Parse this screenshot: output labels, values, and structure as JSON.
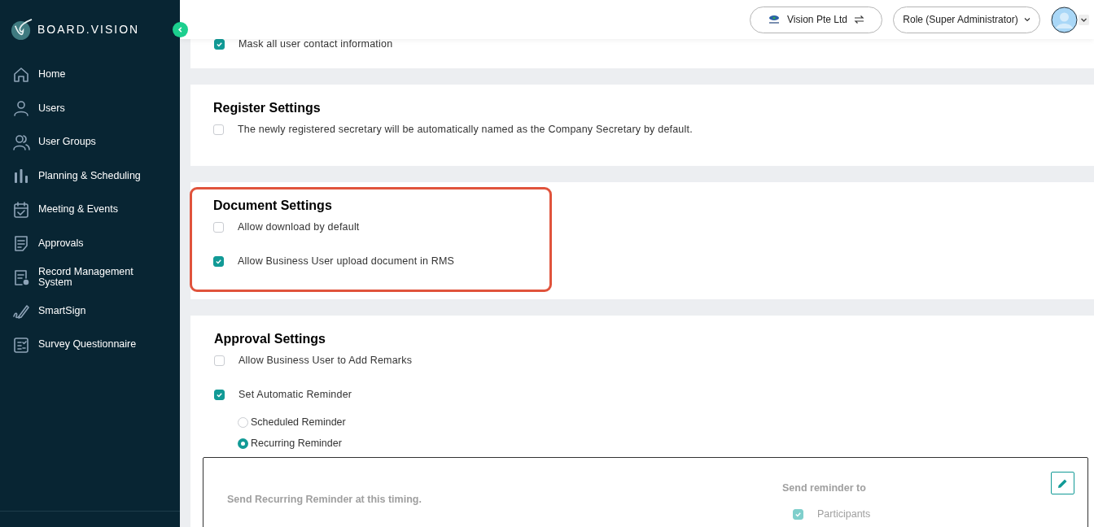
{
  "sidebar": {
    "logo_text": "BOARD.VISION",
    "items": [
      {
        "label": "Home"
      },
      {
        "label": "Users"
      },
      {
        "label": "User Groups"
      },
      {
        "label": "Planning & Scheduling"
      },
      {
        "label": "Meeting & Events"
      },
      {
        "label": "Approvals"
      },
      {
        "label": "Record Management System"
      },
      {
        "label": "SmartSign"
      },
      {
        "label": "Survey Questionnaire"
      }
    ]
  },
  "header": {
    "company": "Vision Pte Ltd",
    "role": "Role (Super Administrator)"
  },
  "sections": [
    {
      "highlighted": false,
      "options": [
        {
          "label": "Mask all user contact information",
          "checked": true
        }
      ]
    },
    {
      "title": "Register Settings",
      "highlighted": false,
      "options": [
        {
          "label": "The newly registered secretary will be automatically named as the Company Secretary by default.",
          "checked": false
        }
      ]
    },
    {
      "title": "Document Settings",
      "highlighted": true,
      "options": [
        {
          "label": "Allow download by default",
          "checked": false
        },
        {
          "label": "Allow Business User upload document in RMS",
          "checked": true
        }
      ]
    },
    {
      "title": "Approval Settings",
      "highlighted": false,
      "options": [
        {
          "label": "Allow Business User to Add Remarks",
          "checked": false
        },
        {
          "label": "Set Automatic Reminder",
          "checked": true
        }
      ],
      "reminder_types": [
        {
          "label": "Scheduled Reminder",
          "selected": false
        },
        {
          "label": "Recurring Reminder",
          "selected": true
        }
      ],
      "reminder_box": {
        "timing_label": "Send Recurring Reminder at this timing.",
        "recipients_label": "Send reminder to",
        "recipients": [
          {
            "label": "Participants",
            "checked": true,
            "disabled": true
          }
        ]
      }
    }
  ]
}
